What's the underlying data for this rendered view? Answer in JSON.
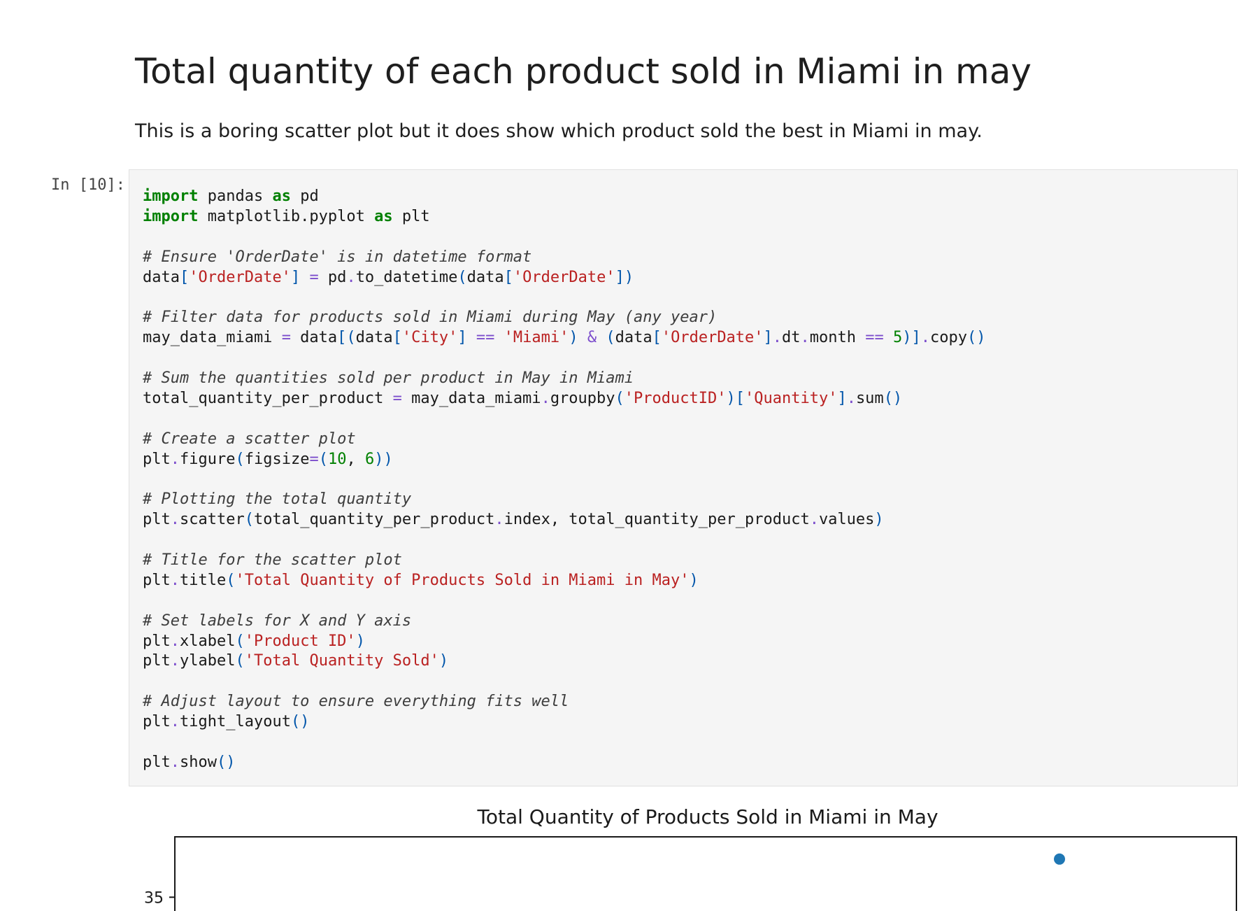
{
  "markdown": {
    "heading": "Total quantity of each product sold in Miami in may",
    "paragraph": "This is a boring scatter plot but it does show which product sold the best in Miami in may."
  },
  "cell": {
    "prompt": "In [10]:",
    "lines": [
      [
        [
          "kw",
          "import"
        ],
        [
          "tx",
          " pandas "
        ],
        [
          "kw",
          "as"
        ],
        [
          "tx",
          " pd"
        ]
      ],
      [
        [
          "kw",
          "import"
        ],
        [
          "tx",
          " matplotlib.pyplot "
        ],
        [
          "kw",
          "as"
        ],
        [
          "tx",
          " plt"
        ]
      ],
      [],
      [
        [
          "cm",
          "# Ensure 'OrderDate' is in datetime format"
        ]
      ],
      [
        [
          "tx",
          "data"
        ],
        [
          "pu",
          "["
        ],
        [
          "st",
          "'OrderDate'"
        ],
        [
          "pu",
          "]"
        ],
        [
          "tx",
          " "
        ],
        [
          "op",
          "="
        ],
        [
          "tx",
          " pd"
        ],
        [
          "op",
          "."
        ],
        [
          "tx",
          "to_datetime"
        ],
        [
          "pu",
          "("
        ],
        [
          "tx",
          "data"
        ],
        [
          "pu",
          "["
        ],
        [
          "st",
          "'OrderDate'"
        ],
        [
          "pu",
          "])"
        ]
      ],
      [],
      [
        [
          "cm",
          "# Filter data for products sold in Miami during May (any year)"
        ]
      ],
      [
        [
          "tx",
          "may_data_miami "
        ],
        [
          "op",
          "="
        ],
        [
          "tx",
          " data"
        ],
        [
          "pu",
          "[("
        ],
        [
          "tx",
          "data"
        ],
        [
          "pu",
          "["
        ],
        [
          "st",
          "'City'"
        ],
        [
          "pu",
          "]"
        ],
        [
          "tx",
          " "
        ],
        [
          "op",
          "=="
        ],
        [
          "tx",
          " "
        ],
        [
          "st",
          "'Miami'"
        ],
        [
          "pu",
          ")"
        ],
        [
          "tx",
          " "
        ],
        [
          "op",
          "&"
        ],
        [
          "tx",
          " "
        ],
        [
          "pu",
          "("
        ],
        [
          "tx",
          "data"
        ],
        [
          "pu",
          "["
        ],
        [
          "st",
          "'OrderDate'"
        ],
        [
          "pu",
          "]"
        ],
        [
          "op",
          "."
        ],
        [
          "tx",
          "dt"
        ],
        [
          "op",
          "."
        ],
        [
          "tx",
          "month "
        ],
        [
          "op",
          "=="
        ],
        [
          "tx",
          " "
        ],
        [
          "nu",
          "5"
        ],
        [
          "pu",
          ")]"
        ],
        [
          "op",
          "."
        ],
        [
          "tx",
          "copy"
        ],
        [
          "pu",
          "()"
        ]
      ],
      [],
      [
        [
          "cm",
          "# Sum the quantities sold per product in May in Miami"
        ]
      ],
      [
        [
          "tx",
          "total_quantity_per_product "
        ],
        [
          "op",
          "="
        ],
        [
          "tx",
          " may_data_miami"
        ],
        [
          "op",
          "."
        ],
        [
          "tx",
          "groupby"
        ],
        [
          "pu",
          "("
        ],
        [
          "st",
          "'ProductID'"
        ],
        [
          "pu",
          ")["
        ],
        [
          "st",
          "'Quantity'"
        ],
        [
          "pu",
          "]"
        ],
        [
          "op",
          "."
        ],
        [
          "tx",
          "sum"
        ],
        [
          "pu",
          "()"
        ]
      ],
      [],
      [
        [
          "cm",
          "# Create a scatter plot"
        ]
      ],
      [
        [
          "tx",
          "plt"
        ],
        [
          "op",
          "."
        ],
        [
          "tx",
          "figure"
        ],
        [
          "pu",
          "("
        ],
        [
          "tx",
          "figsize"
        ],
        [
          "op",
          "="
        ],
        [
          "pu",
          "("
        ],
        [
          "nu",
          "10"
        ],
        [
          "tx",
          ", "
        ],
        [
          "nu",
          "6"
        ],
        [
          "pu",
          "))"
        ]
      ],
      [],
      [
        [
          "cm",
          "# Plotting the total quantity"
        ]
      ],
      [
        [
          "tx",
          "plt"
        ],
        [
          "op",
          "."
        ],
        [
          "tx",
          "scatter"
        ],
        [
          "pu",
          "("
        ],
        [
          "tx",
          "total_quantity_per_product"
        ],
        [
          "op",
          "."
        ],
        [
          "tx",
          "index, total_quantity_per_product"
        ],
        [
          "op",
          "."
        ],
        [
          "tx",
          "values"
        ],
        [
          "pu",
          ")"
        ]
      ],
      [],
      [
        [
          "cm",
          "# Title for the scatter plot"
        ]
      ],
      [
        [
          "tx",
          "plt"
        ],
        [
          "op",
          "."
        ],
        [
          "tx",
          "title"
        ],
        [
          "pu",
          "("
        ],
        [
          "st",
          "'Total Quantity of Products Sold in Miami in May'"
        ],
        [
          "pu",
          ")"
        ]
      ],
      [],
      [
        [
          "cm",
          "# Set labels for X and Y axis"
        ]
      ],
      [
        [
          "tx",
          "plt"
        ],
        [
          "op",
          "."
        ],
        [
          "tx",
          "xlabel"
        ],
        [
          "pu",
          "("
        ],
        [
          "st",
          "'Product ID'"
        ],
        [
          "pu",
          ")"
        ]
      ],
      [
        [
          "tx",
          "plt"
        ],
        [
          "op",
          "."
        ],
        [
          "tx",
          "ylabel"
        ],
        [
          "pu",
          "("
        ],
        [
          "st",
          "'Total Quantity Sold'"
        ],
        [
          "pu",
          ")"
        ]
      ],
      [],
      [
        [
          "cm",
          "# Adjust layout to ensure everything fits well"
        ]
      ],
      [
        [
          "tx",
          "plt"
        ],
        [
          "op",
          "."
        ],
        [
          "tx",
          "tight_layout"
        ],
        [
          "pu",
          "()"
        ]
      ],
      [],
      [
        [
          "tx",
          "plt"
        ],
        [
          "op",
          "."
        ],
        [
          "tx",
          "show"
        ],
        [
          "pu",
          "()"
        ]
      ]
    ]
  },
  "chart_data": {
    "type": "scatter",
    "title": "Total Quantity of Products Sold in Miami in May",
    "yticks": [
      35
    ],
    "series": [
      {
        "x": [
          1
        ],
        "y": [
          36.2
        ]
      }
    ],
    "x_visible_range": [
      0,
      1.2
    ],
    "y_visible_range": [
      33.95,
      36.9
    ],
    "marker_color": "#1f77b4",
    "grid": false
  }
}
